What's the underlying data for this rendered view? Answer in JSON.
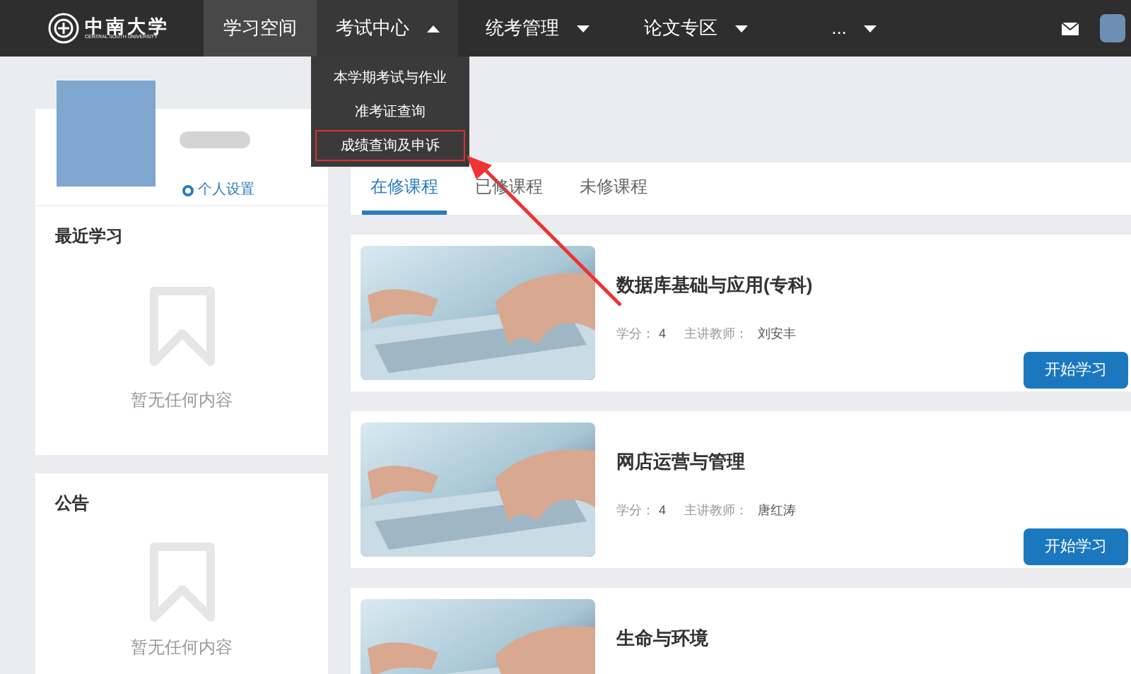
{
  "navbar": {
    "logo": {
      "name": "中南大学",
      "subtitle": "CENTRAL SOUTH UNIVERSITY"
    },
    "items": [
      {
        "label": "学习空间",
        "kind": "link",
        "selected": true,
        "expanded": false
      },
      {
        "label": "考试中心",
        "kind": "menu",
        "selected": false,
        "expanded": true
      },
      {
        "label": "统考管理",
        "kind": "menu",
        "selected": false,
        "expanded": false
      },
      {
        "label": "论文专区",
        "kind": "menu",
        "selected": false,
        "expanded": false
      },
      {
        "label": "...",
        "kind": "menu",
        "selected": false,
        "expanded": false
      }
    ],
    "dropdown": [
      {
        "label": "本学期考试与作业",
        "highlighted": false
      },
      {
        "label": "准考证查询",
        "highlighted": false
      },
      {
        "label": "成绩查询及申诉",
        "highlighted": true
      }
    ]
  },
  "profile": {
    "settings_link": "个人设置"
  },
  "sidebar_sections": [
    {
      "title": "最近学习",
      "empty_text": "暂无任何内容"
    },
    {
      "title": "公告",
      "empty_text": "暂无任何内容"
    }
  ],
  "tabs": [
    {
      "label": "在修课程",
      "selected": true
    },
    {
      "label": "已修课程",
      "selected": false
    },
    {
      "label": "未修课程",
      "selected": false
    }
  ],
  "courses": [
    {
      "title": "数据库基础与应用(专科)",
      "credit_label": "学分：",
      "credit": "4",
      "teacher_label": "主讲教师：",
      "teacher": "刘安丰",
      "button": "开始学习"
    },
    {
      "title": "网店运营与管理",
      "credit_label": "学分：",
      "credit": "4",
      "teacher_label": "主讲教师：",
      "teacher": "唐红涛",
      "button": "开始学习"
    },
    {
      "title": "生命与环境"
    }
  ]
}
